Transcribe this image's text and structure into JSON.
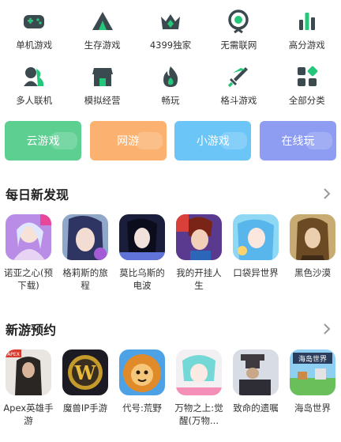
{
  "categories": [
    {
      "label": "单机游戏",
      "icon": "gamepad-icon"
    },
    {
      "label": "生存游戏",
      "icon": "tent-icon"
    },
    {
      "label": "4399独家",
      "icon": "crown-icon"
    },
    {
      "label": "无需联网",
      "icon": "no-wifi-icon"
    },
    {
      "label": "高分游戏",
      "icon": "bar-chart-icon"
    },
    {
      "label": "多人联机",
      "icon": "multiplayer-icon"
    },
    {
      "label": "模拟经营",
      "icon": "shop-icon"
    },
    {
      "label": "畅玩",
      "icon": "flame-icon"
    },
    {
      "label": "格斗游戏",
      "icon": "sword-icon"
    },
    {
      "label": "全部分类",
      "icon": "grid-icon"
    }
  ],
  "tiles": [
    {
      "label": "云游戏",
      "color": "#5ccf91"
    },
    {
      "label": "网游",
      "color": "#fbb16f"
    },
    {
      "label": "小游戏",
      "color": "#6cc5f7"
    },
    {
      "label": "在线玩",
      "color": "#8e9cf2"
    }
  ],
  "daily": {
    "title": "每日新发现",
    "games": [
      {
        "name": "诺亚之心(预下载)"
      },
      {
        "name": "格莉斯的旅程"
      },
      {
        "name": "莫比乌斯的电波"
      },
      {
        "name": "我的开挂人生"
      },
      {
        "name": "口袋异世界"
      },
      {
        "name": "黑色沙漠"
      }
    ]
  },
  "preorder": {
    "title": "新游预约",
    "games": [
      {
        "name": "Apex英雄手游"
      },
      {
        "name": "魔兽IP手游"
      },
      {
        "name": "代号:荒野"
      },
      {
        "name": "万物之上:觉醒(万物..."
      },
      {
        "name": "致命的遗嘱"
      },
      {
        "name": "海岛世界"
      }
    ],
    "thumb_text": {
      "apex": "APEX",
      "wow": "W",
      "island": "海岛世界"
    }
  },
  "colors": {
    "icon_dark": "#3b4a4f",
    "icon_accent": "#24c77a"
  }
}
